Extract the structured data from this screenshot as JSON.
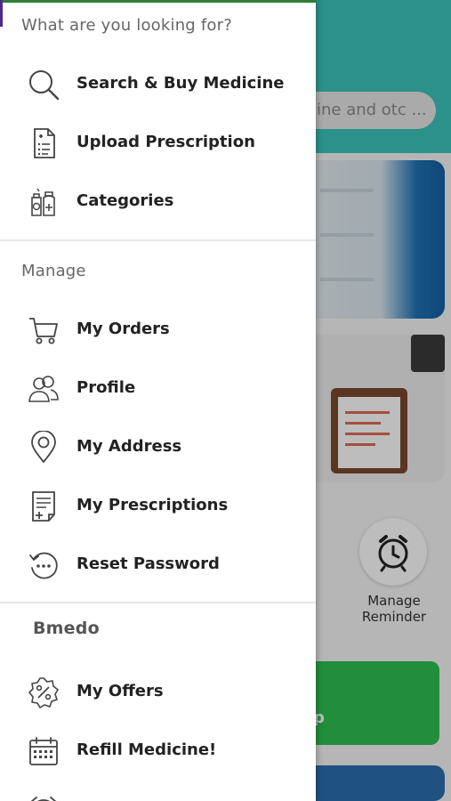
{
  "background": {
    "search_placeholder": "ine and otc ...",
    "manage_reminder_label": "Manage Reminder",
    "green_banner_text": "p"
  },
  "drawer": {
    "header": "What are you looking for?",
    "primary_items": [
      {
        "label": "Search & Buy Medicine",
        "icon": "search-icon"
      },
      {
        "label": "Upload Prescription",
        "icon": "prescription-upload-icon"
      },
      {
        "label": "Categories",
        "icon": "categories-icon"
      }
    ],
    "manage_title": "Manage",
    "manage_items": [
      {
        "label": "My Orders",
        "icon": "cart-icon"
      },
      {
        "label": "Profile",
        "icon": "profile-icon"
      },
      {
        "label": "My Address",
        "icon": "location-pin-icon"
      },
      {
        "label": "My Prescriptions",
        "icon": "prescription-doc-icon"
      },
      {
        "label": "Reset Password",
        "icon": "reset-password-icon"
      }
    ],
    "bmedo_title": "Bmedo",
    "bmedo_items": [
      {
        "label": "My Offers",
        "icon": "offer-badge-icon"
      },
      {
        "label": "Refill Medicine!",
        "icon": "calendar-icon"
      }
    ]
  },
  "colors": {
    "header_teal": "#3cc4bb",
    "drawer_bg": "#ffffff",
    "text_primary": "#222222",
    "section_text": "#666666"
  }
}
